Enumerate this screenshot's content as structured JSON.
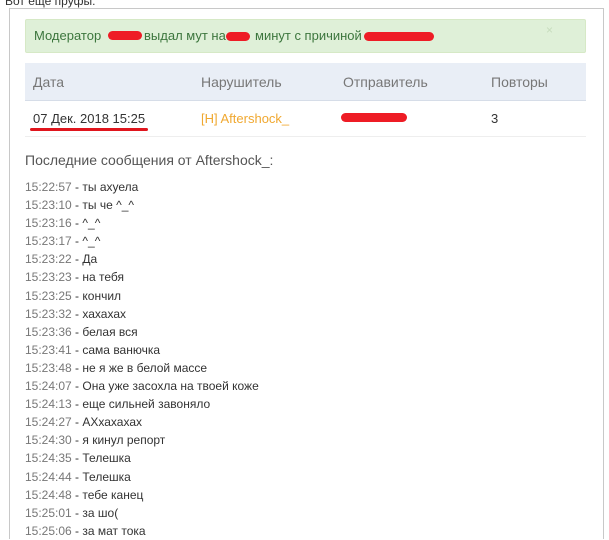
{
  "caption": "Вот еще пруфы:",
  "alert": {
    "moderator_label": "Модератор",
    "action_text": "выдал мут на",
    "minutes_text": "минут с причиной",
    "close_symbol": "×"
  },
  "table": {
    "headers": [
      "Дата",
      "Нарушитель",
      "Отправитель",
      "Повторы"
    ],
    "row": {
      "date": "07 Дек. 2018 15:25",
      "violator": "[H] Aftershock_",
      "repeats": "3"
    }
  },
  "recent_title": "Последние сообщения от Aftershock_:",
  "messages": [
    {
      "time": "15:22:57",
      "text": " - ты ахуела"
    },
    {
      "time": "15:23:10",
      "text": " - ты че ^_^"
    },
    {
      "time": "15:23:16",
      "text": " - ^_^"
    },
    {
      "time": "15:23:17",
      "text": " - ^_^"
    },
    {
      "time": "15:23:22",
      "text": " - Да"
    },
    {
      "time": "15:23:23",
      "text": " - на тебя"
    },
    {
      "time": "15:23:25",
      "text": " - кончил"
    },
    {
      "time": "15:23:32",
      "text": " - хахахах"
    },
    {
      "time": "15:23:36",
      "text": " - белая вся"
    },
    {
      "time": "15:23:41",
      "text": " - сама ванючка"
    },
    {
      "time": "15:23:48",
      "text": " - не я же в белой массе"
    },
    {
      "time": "15:24:07",
      "text": " - Она уже засохла на твоей коже"
    },
    {
      "time": "15:24:13",
      "text": " - еще сильней завоняло"
    },
    {
      "time": "15:24:27",
      "text": " - АХхахахах"
    },
    {
      "time": "15:24:30",
      "text": " - я кинул репорт"
    },
    {
      "time": "15:24:35",
      "text": " - Телешка"
    },
    {
      "time": "15:24:44",
      "text": " - Телешка"
    },
    {
      "time": "15:24:48",
      "text": " - тебе канец"
    },
    {
      "time": "15:25:01",
      "text": " - за шо("
    },
    {
      "time": "15:25:06",
      "text": " - за мат тока"
    }
  ],
  "colors": {
    "alert_bg": "#dff0d8",
    "alert_text": "#3c763d",
    "header_bg": "#e9eef6",
    "violator": "#f0a830",
    "redaction": "#ee1c25"
  }
}
